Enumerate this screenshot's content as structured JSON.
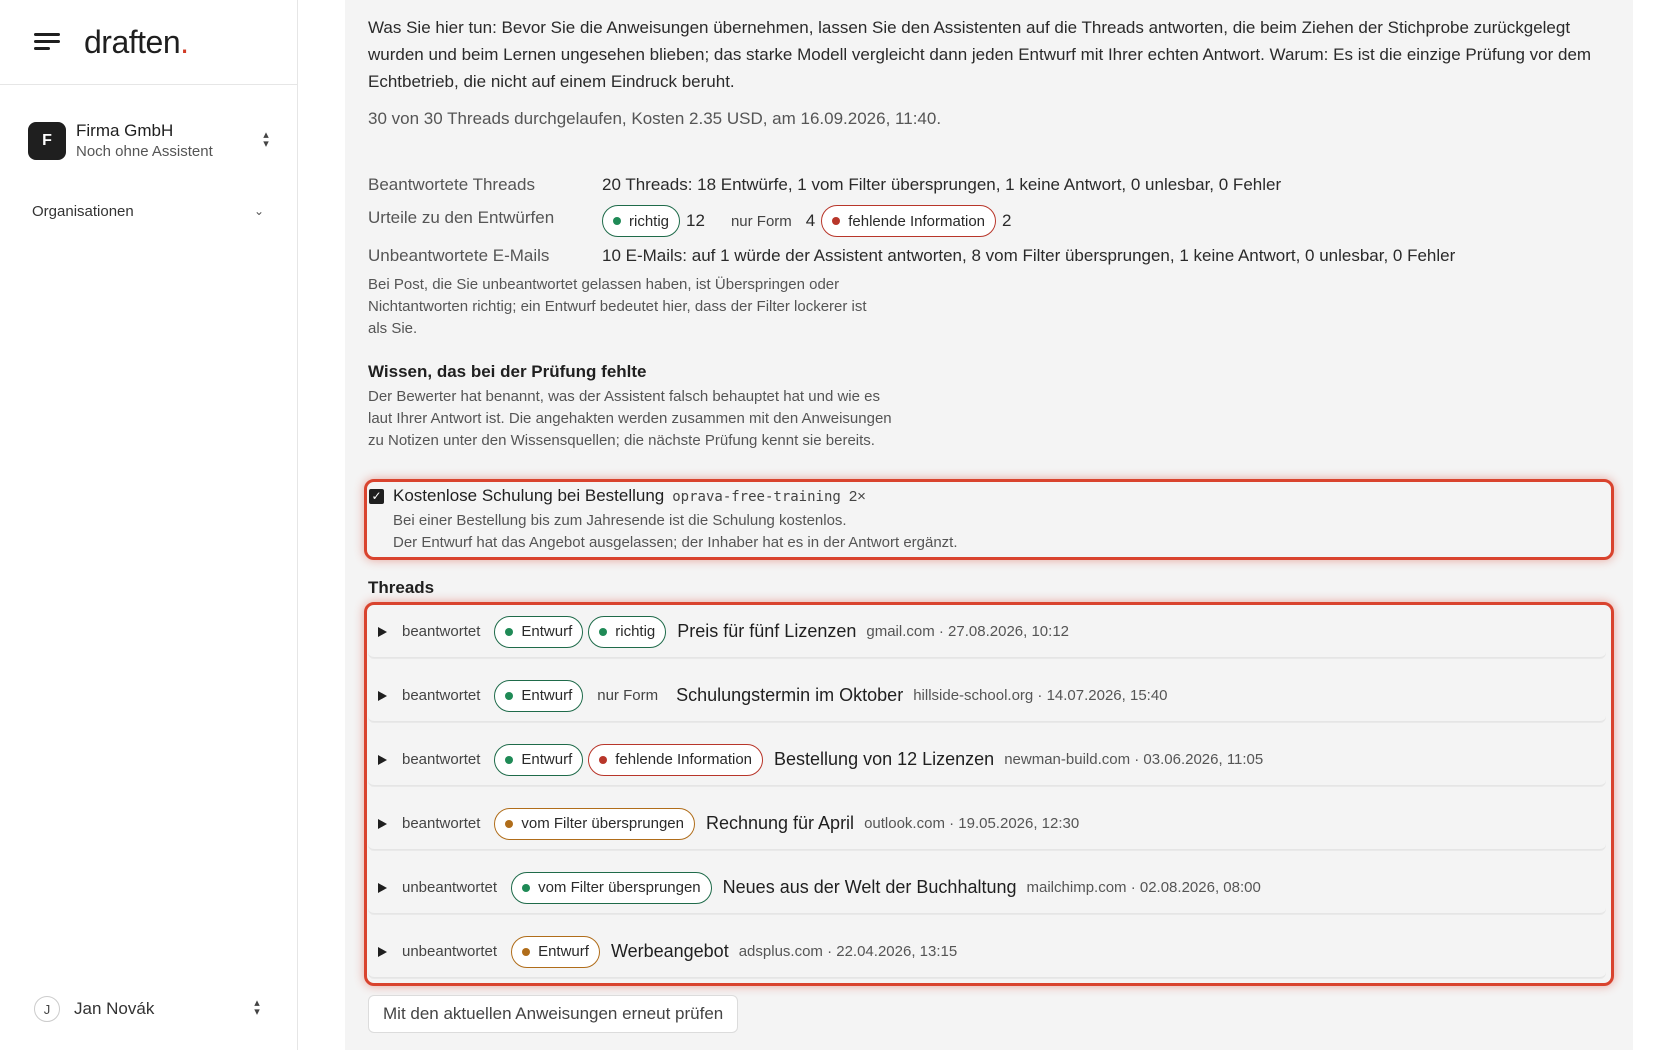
{
  "app": {
    "logo_text": "draften",
    "logo_dot": "."
  },
  "sidebar": {
    "org": {
      "initial": "F",
      "name": "Firma GmbH",
      "subtitle": "Noch ohne Assistent"
    },
    "orgs_nav_label": "Organisationen",
    "user": {
      "initial": "J",
      "name": "Jan Novák"
    }
  },
  "main": {
    "intro": "Was Sie hier tun: Bevor Sie die Anweisungen übernehmen, lassen Sie den Assistenten auf die Threads antworten, die beim Ziehen der Stichprobe zurückgelegt wurden und beim Lernen ungesehen blieben; das starke Modell vergleicht dann jeden Entwurf mit Ihrer echten Antwort. Warum: Es ist die einzige Prüfung vor dem Echtbetrieb, die nicht auf einem Eindruck beruht.",
    "run_info": "30 von 30 Threads durchgelaufen, Kosten 2.35 USD, am 16.09.2026, 11:40.",
    "answered_label": "Beantwortete Threads",
    "answered_value": "20 Threads: 18 Entwürfe, 1 vom Filter übersprungen, 1 keine Antwort, 0 unlesbar, 0 Fehler",
    "verdicts_label": "Urteile zu den Entwürfen",
    "verdicts": {
      "correct_label": "richtig",
      "correct_count": "12",
      "form_label": "nur Form",
      "form_count": "4",
      "missing_label": "fehlende Information",
      "missing_count": "2"
    },
    "unanswered_label": "Unbeantwortete E-Mails",
    "unanswered_value": "10 E-Mails: auf 1 würde der Assistent antworten, 8 vom Filter übersprungen, 1 keine Antwort, 0 unlesbar, 0 Fehler",
    "unanswered_note": "Bei Post, die Sie unbeantwortet gelassen haben, ist Überspringen oder Nichtantworten richtig; ein Entwurf bedeutet hier, dass der Filter lockerer ist als Sie.",
    "knowledge_heading": "Wissen, das bei der Prüfung fehlte",
    "knowledge_note": "Der Bewerter hat benannt, was der Assistent falsch behauptet hat und wie es laut Ihrer Antwort ist. Die angehakten werden zusammen mit den Anweisungen zu Notizen unter den Wissensquellen; die nächste Prüfung kennt sie bereits.",
    "knowledge_item": {
      "title": "Kostenlose Schulung bei Bestellung",
      "code": "oprava-free-training",
      "count": "2×",
      "line1": "Bei einer Bestellung bis zum Jahresende ist die Schulung kostenlos.",
      "line2": "Der Entwurf hat das Angebot ausgelassen; der Inhaber hat es in der Antwort ergänzt."
    },
    "threads_heading": "Threads",
    "threads": [
      {
        "state": "beantwortet",
        "pill1": "Entwurf",
        "pill2": "richtig",
        "subject": "Preis für fünf Lizenzen",
        "meta": "gmail.com · 27.08.2026, 10:12"
      },
      {
        "state": "beantwortet",
        "pill1": "Entwurf",
        "tag": "nur Form",
        "subject": "Schulungstermin im Oktober",
        "meta": "hillside-school.org · 14.07.2026, 15:40"
      },
      {
        "state": "beantwortet",
        "pill1": "Entwurf",
        "pill2": "fehlende Information",
        "subject": "Bestellung von 12 Lizenzen",
        "meta": "newman-build.com · 03.06.2026, 11:05"
      },
      {
        "state": "beantwortet",
        "pill1": "vom Filter übersprungen",
        "subject": "Rechnung für April",
        "meta": "outlook.com · 19.05.2026, 12:30"
      },
      {
        "state": "unbeantwortet",
        "pill1": "vom Filter übersprungen",
        "subject": "Neues aus der Welt der Buchhaltung",
        "meta": "mailchimp.com · 02.08.2026, 08:00"
      },
      {
        "state": "unbeantwortet",
        "pill1": "Entwurf",
        "subject": "Werbeangebot",
        "meta": "adsplus.com · 22.04.2026, 13:15"
      }
    ],
    "retry_button": "Mit den aktuellen Anweisungen erneut prüfen"
  },
  "colors": {
    "accent_red": "#d13b26",
    "highlight": "#d9432e",
    "green": "#1f8a56",
    "red": "#b8362a",
    "amber": "#b06d1a"
  }
}
